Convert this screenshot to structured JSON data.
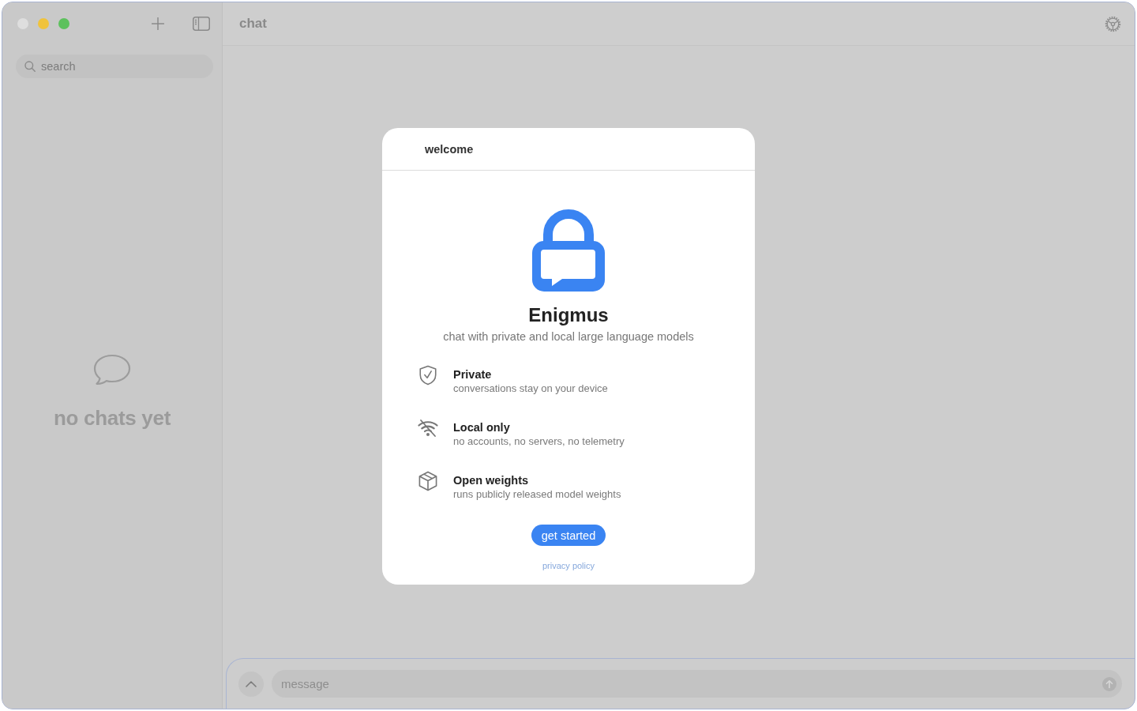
{
  "window": {
    "controls": [
      {
        "kind": "close",
        "disabled": true
      },
      {
        "kind": "minimize",
        "disabled": false
      },
      {
        "kind": "zoom",
        "disabled": false
      }
    ],
    "title": "chat"
  },
  "sidebar": {
    "search": {
      "placeholder": "search"
    },
    "empty_state": "no chats yet"
  },
  "dialog": {
    "title": "welcome",
    "app_name": "Enigmus",
    "tagline": "chat with private and local large language models",
    "features": [
      {
        "kind": "shield",
        "title": "Private",
        "description": "conversations stay on your device"
      },
      {
        "kind": "offline",
        "title": "Local only",
        "description": "no accounts, no servers, no telemetry"
      },
      {
        "kind": "package",
        "title": "Open weights",
        "description": "runs publicly released model weights"
      }
    ],
    "primary_button": "get started",
    "link": "privacy policy"
  },
  "composer": {
    "placeholder": "message"
  }
}
